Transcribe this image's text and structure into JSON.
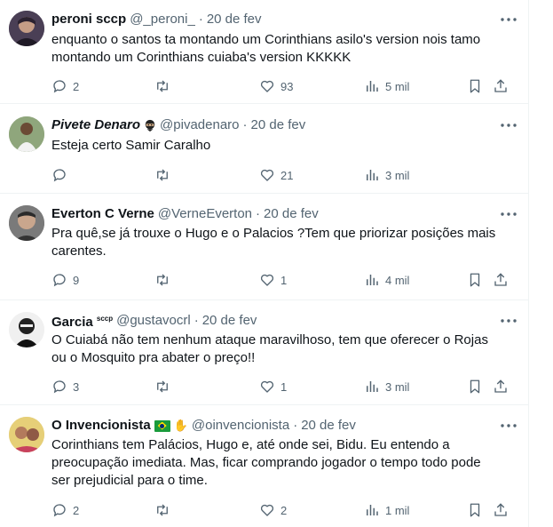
{
  "tweets": [
    {
      "name": "peroni sccp",
      "handle": "@_peroni_",
      "sep": "·",
      "date": "20 de fev",
      "text": [
        "enquanto o santos ta montando um Corinthians asilo's version nois tamo",
        "montando um Corinthians cuiaba's version KKKKK"
      ],
      "replies": "2",
      "retweets": "",
      "likes": "93",
      "views": "5 mil"
    },
    {
      "name": "Pivete Denaro",
      "handle": "@pivadenaro",
      "sep": "·",
      "date": "20 de fev",
      "text": [
        "Esteja certo Samir Caralho"
      ],
      "replies": "",
      "retweets": "",
      "likes": "21",
      "views": "3 mil"
    },
    {
      "name": "Everton C Verne",
      "handle": "@VerneEverton",
      "sep": "·",
      "date": "20 de fev",
      "text": [
        "Pra quê,se já trouxe o Hugo e o Palacios ?Tem que priorizar posições mais",
        "carentes."
      ],
      "replies": "9",
      "retweets": "",
      "likes": "1",
      "views": "4 mil"
    },
    {
      "name": "Garcia",
      "badge": "sccp",
      "handle": "@gustavocrl",
      "sep": "·",
      "date": "20 de fev",
      "text": [
        "O Cuiabá não tem nenhum ataque maravilhoso, tem que oferecer o Rojas",
        "ou o Mosquito pra abater o preço!!"
      ],
      "replies": "3",
      "retweets": "",
      "likes": "1",
      "views": "3 mil"
    },
    {
      "name": "O Invencionista",
      "handle": "@oinvencionista",
      "sep": "·",
      "date": "20 de fev",
      "text": [
        "Corinthians tem Palácios, Hugo e, até onde sei, Bidu. Eu entendo a",
        "preocupação imediata. Mas, ficar comprando jogador o tempo todo pode",
        "ser prejudicial para o time."
      ],
      "replies": "2",
      "retweets": "",
      "likes": "2",
      "views": "1 mil"
    }
  ],
  "icons": {
    "more": "more-icon",
    "reply": "reply-icon",
    "retweet": "retweet-icon",
    "like": "like-icon",
    "views": "views-icon",
    "bookmark": "bookmark-icon",
    "share": "share-icon"
  },
  "colors": {
    "text": "#0f1419",
    "muted": "#536471",
    "border": "#eff3f4"
  }
}
